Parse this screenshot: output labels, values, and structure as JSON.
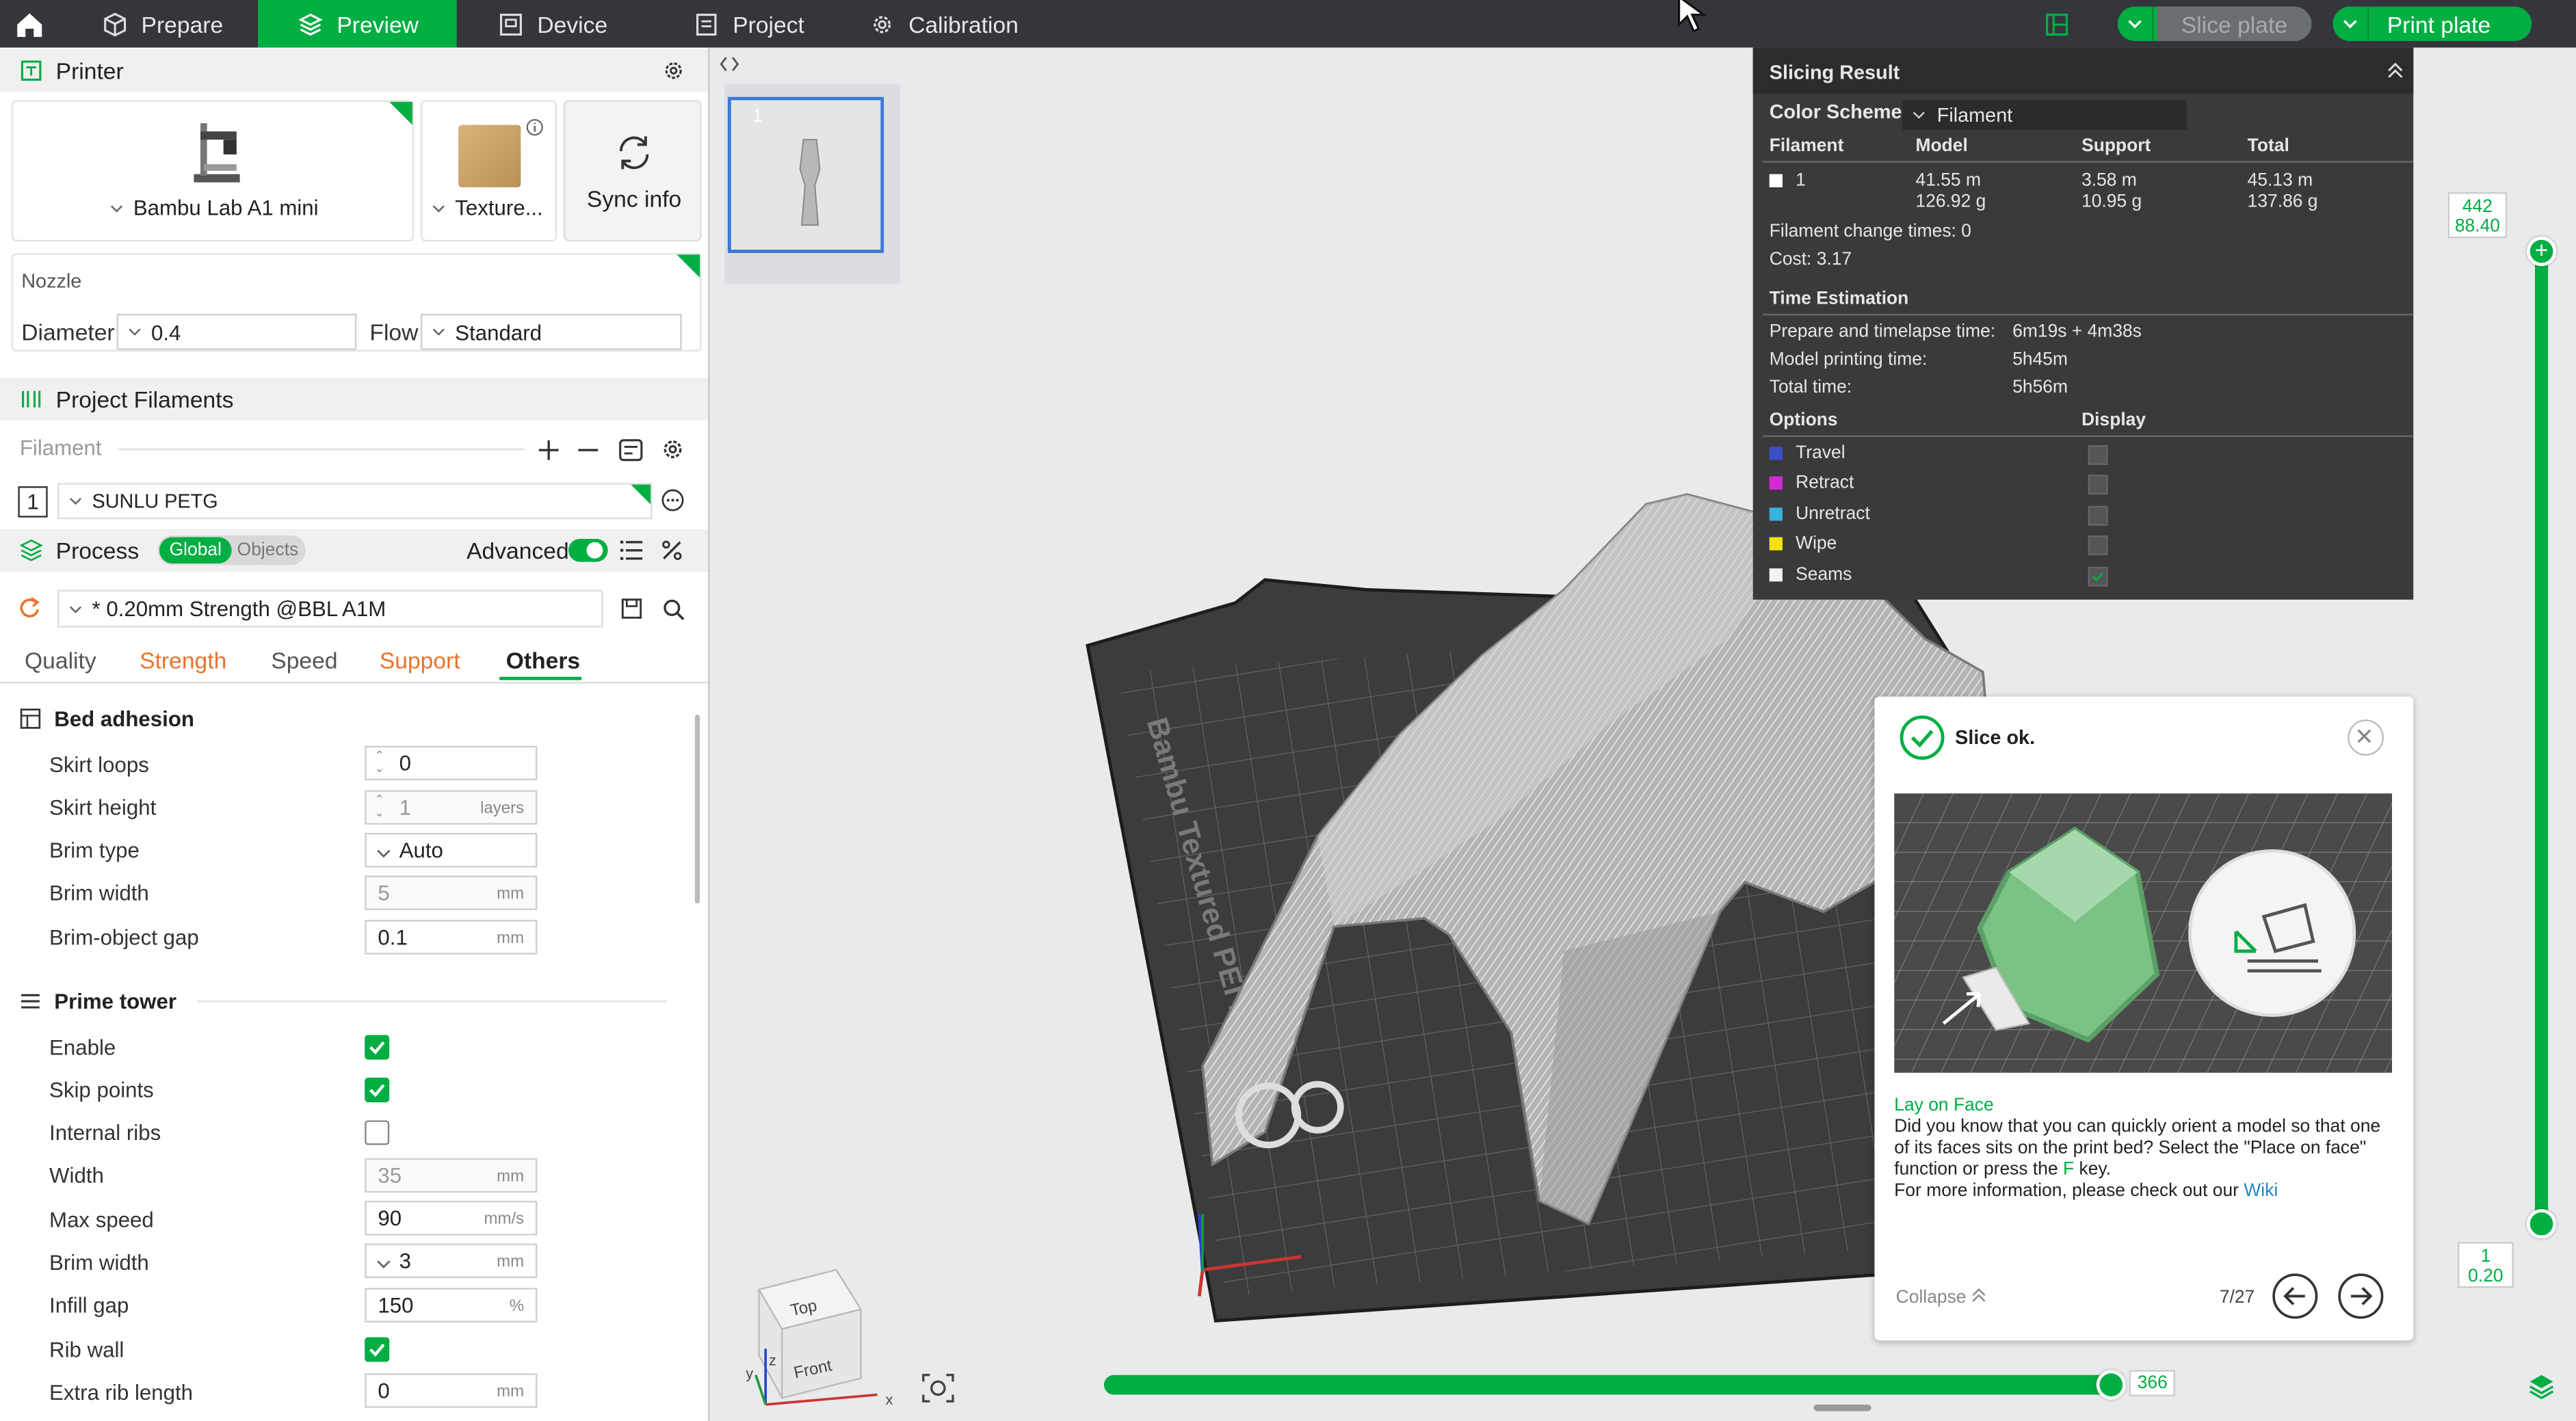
{
  "topbar": {
    "tabs": [
      {
        "label": "Prepare"
      },
      {
        "label": "Preview"
      },
      {
        "label": "Device"
      },
      {
        "label": "Project"
      },
      {
        "label": "Calibration"
      }
    ],
    "slice_label": "Slice plate",
    "print_label": "Print plate"
  },
  "printer": {
    "title": "Printer",
    "name": "Bambu Lab A1 mini",
    "plate": "Texture...",
    "sync": "Sync info",
    "nozzle_title": "Nozzle",
    "diameter_label": "Diameter",
    "diameter_value": "0.4",
    "flow_label": "Flow",
    "flow_value": "Standard"
  },
  "filaments": {
    "title": "Project Filaments",
    "column": "Filament",
    "items": [
      {
        "index": "1",
        "name": "SUNLU PETG"
      }
    ]
  },
  "process": {
    "title": "Process",
    "global": "Global",
    "objects": "Objects",
    "advanced": "Advanced",
    "preset": "* 0.20mm Strength @BBL A1M",
    "tabs": [
      "Quality",
      "Strength",
      "Speed",
      "Support",
      "Others"
    ],
    "active_tab": "Others",
    "bed_adhesion": {
      "title": "Bed adhesion",
      "skirt_loops": {
        "label": "Skirt loops",
        "value": "0"
      },
      "skirt_height": {
        "label": "Skirt height",
        "value": "1",
        "unit": "layers"
      },
      "brim_type": {
        "label": "Brim type",
        "value": "Auto"
      },
      "brim_width": {
        "label": "Brim width",
        "value": "5",
        "unit": "mm"
      },
      "brim_gap": {
        "label": "Brim-object gap",
        "value": "0.1",
        "unit": "mm"
      }
    },
    "prime_tower": {
      "title": "Prime tower",
      "enable": {
        "label": "Enable",
        "checked": true
      },
      "skip_points": {
        "label": "Skip points",
        "checked": true
      },
      "internal_ribs": {
        "label": "Internal ribs",
        "checked": false
      },
      "width": {
        "label": "Width",
        "value": "35",
        "unit": "mm"
      },
      "max_speed": {
        "label": "Max speed",
        "value": "90",
        "unit": "mm/s"
      },
      "brim_width": {
        "label": "Brim width",
        "value": "3",
        "unit": "mm"
      },
      "infill_gap": {
        "label": "Infill gap",
        "value": "150",
        "unit": "%"
      },
      "rib_wall": {
        "label": "Rib wall",
        "checked": true
      },
      "extra_rib_length": {
        "label": "Extra rib length",
        "value": "0",
        "unit": "mm"
      }
    }
  },
  "plate_thumb": {
    "number": "1"
  },
  "bed_label": "Bambu Textured PEI Plate",
  "slicing_result": {
    "title": "Slicing Result",
    "color_scheme_label": "Color Scheme",
    "color_scheme_value": "Filament",
    "headers": [
      "Filament",
      "Model",
      "Support",
      "Total"
    ],
    "row": {
      "filament": "1",
      "model_m": "41.55 m",
      "model_g": "126.92 g",
      "support_m": "3.58 m",
      "support_g": "10.95 g",
      "total_m": "45.13 m",
      "total_g": "137.86 g"
    },
    "change_times": "Filament change times:  0",
    "cost": "Cost:  3.17",
    "time_title": "Time Estimation",
    "prepare_label": "Prepare and timelapse time:",
    "prepare_value": "6m19s + 4m38s",
    "model_label": "Model printing time:",
    "model_value": "5h45m",
    "total_label": "Total time:",
    "total_value": "5h56m",
    "options_title": "Options",
    "display_title": "Display",
    "options": [
      {
        "name": "Travel",
        "color": "#3a4fc7",
        "checked": false
      },
      {
        "name": "Retract",
        "color": "#d22ad6",
        "checked": false
      },
      {
        "name": "Unretract",
        "color": "#3ab0dc",
        "checked": false
      },
      {
        "name": "Wipe",
        "color": "#f2e20e",
        "checked": false
      },
      {
        "name": "Seams",
        "color": "#f2f2f2",
        "checked": true
      }
    ]
  },
  "tip": {
    "status": "Slice ok.",
    "heading": "Lay on Face",
    "body_1": "Did you know that you can quickly orient a model so that one of its faces sits on the print bed? Select the \"Place on face\" function or press the",
    "key": "F",
    "body_2": "key.",
    "body_3": "For more information, please check out our",
    "wiki": "Wiki",
    "collapse": "Collapse",
    "page": "7/27"
  },
  "layer_slider": {
    "top_layer": "442",
    "top_height": "88.40",
    "bottom_layer": "1",
    "bottom_height": "0.20",
    "top_fraction": 1.0,
    "bottom_fraction": 0.0
  },
  "move_slider": {
    "value": "366",
    "fraction": 1.0
  },
  "view_cube": {
    "top": "Top",
    "front": "Front"
  },
  "axes": {
    "x": "x",
    "y": "y",
    "z": "z"
  }
}
